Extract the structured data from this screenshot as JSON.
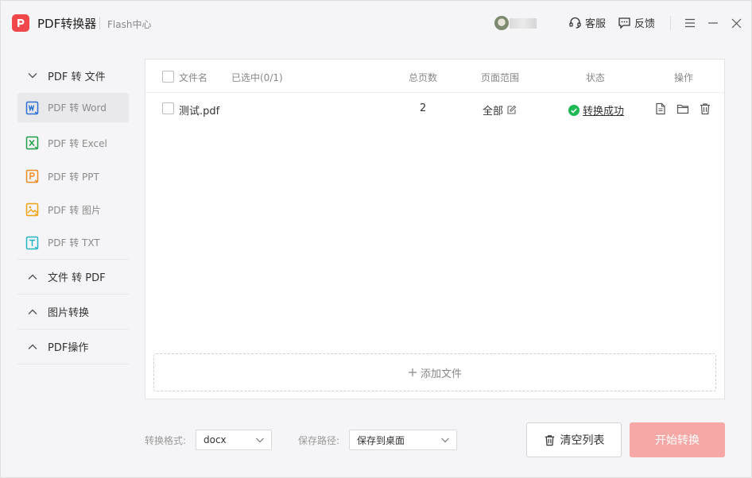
{
  "titlebar": {
    "app_name": "PDF转换器",
    "flash_link": "Flash中心",
    "service_label": "客服",
    "feedback_label": "反馈"
  },
  "sidebar": {
    "groups": [
      {
        "label": "PDF 转 文件",
        "expanded": true,
        "items": [
          {
            "label": "PDF 转 Word",
            "icon": "word-file-icon",
            "letter": "W",
            "color": "#2b6fd6",
            "active": true
          },
          {
            "label": "PDF 转 Excel",
            "icon": "excel-file-icon",
            "letter": "X",
            "color": "#1f9e48",
            "active": false
          },
          {
            "label": "PDF 转 PPT",
            "icon": "ppt-file-icon",
            "letter": "P",
            "color": "#f08a1e",
            "active": false
          },
          {
            "label": "PDF 转 图片",
            "icon": "image-file-icon",
            "letter": "",
            "color": "#f2a20f",
            "active": false
          },
          {
            "label": "PDF 转 TXT",
            "icon": "txt-file-icon",
            "letter": "T",
            "color": "#23b5c7",
            "active": false
          }
        ]
      },
      {
        "label": "文件 转 PDF",
        "expanded": false
      },
      {
        "label": "图片转换",
        "expanded": false
      },
      {
        "label": "PDF操作",
        "expanded": false
      }
    ]
  },
  "table": {
    "headers": {
      "filename": "文件名",
      "selected": "已选中(0/1)",
      "pages": "总页数",
      "range": "页面范围",
      "status": "状态",
      "actions": "操作"
    },
    "rows": [
      {
        "filename": "测试.pdf",
        "pages": "2",
        "range": "全部",
        "status": "转换成功"
      }
    ],
    "add_file_label": "添加文件"
  },
  "bottom": {
    "format_label": "转换格式:",
    "format_value": "docx",
    "path_label": "保存路径:",
    "path_value": "保存到桌面",
    "clear_label": "清空列表",
    "start_label": "开始转换"
  },
  "colors": {
    "brand": "#f0484a",
    "success": "#1db954",
    "start_button": "#f5a8a5"
  }
}
